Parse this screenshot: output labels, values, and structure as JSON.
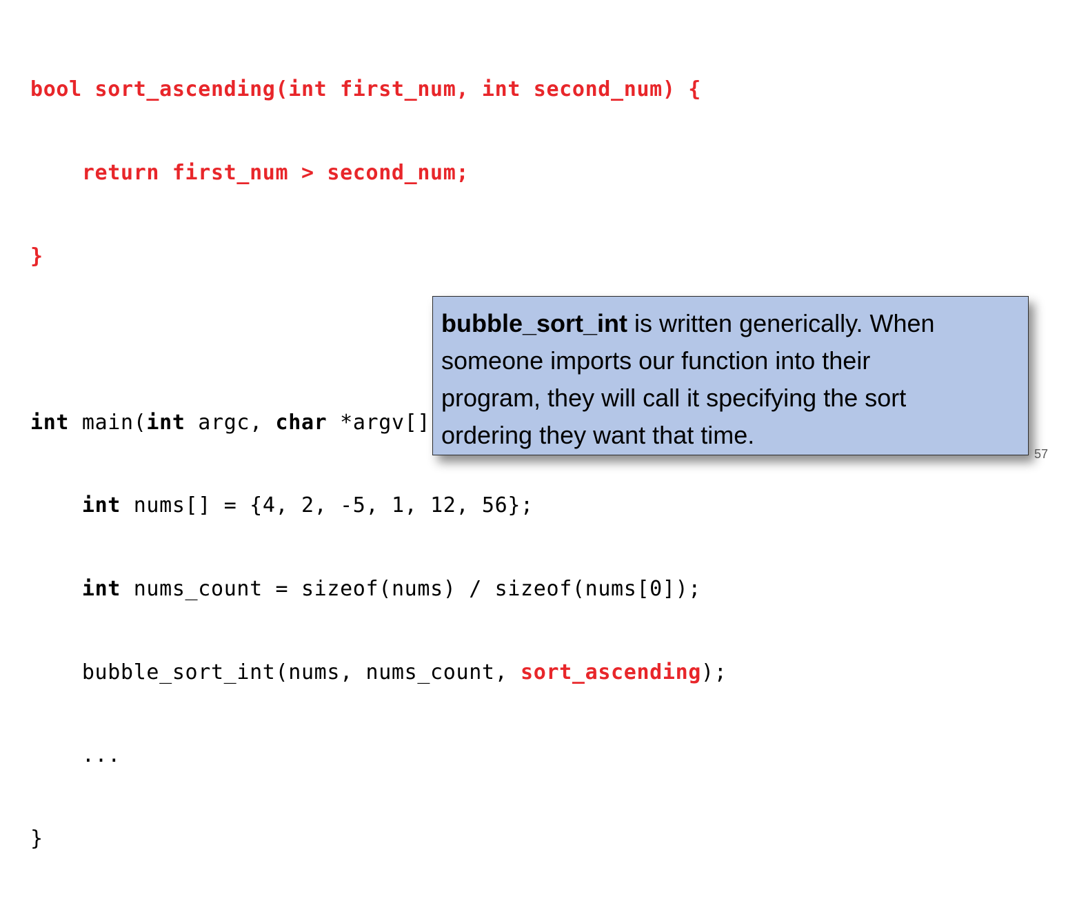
{
  "code": {
    "line1": {
      "text": "bool sort_ascending(int first_num, int second_num) {"
    },
    "line2": {
      "text": "    return first_num > second_num;"
    },
    "line3": {
      "text": "}"
    },
    "line5": {
      "kw1": "int",
      "t1": " main(",
      "kw2": "int",
      "t2": " argc, ",
      "kw3": "char",
      "t3": " *argv[]) {"
    },
    "line6": {
      "indent": "    ",
      "kw1": "int",
      "t1": " nums[] = {4, 2, -5, 1, 12, 56};"
    },
    "line7": {
      "indent": "    ",
      "kw1": "int",
      "t1": " nums_count = sizeof(nums) / sizeof(nums[0]);"
    },
    "line8": {
      "t1": "    bubble_sort_int(nums, nums_count, ",
      "highlight": "sort_ascending",
      "t2": ");"
    },
    "line9": {
      "text": "    ..."
    },
    "line10": {
      "text": "}"
    }
  },
  "callout": {
    "bold_term": "bubble_sort_int",
    "line1_rest": " is written generically.  When",
    "line2": "someone imports our function into their",
    "line3": "program, they will call it specifying the sort",
    "line4": "ordering they want that time."
  },
  "slide": {
    "page_number": "57"
  },
  "colors": {
    "highlight_red": "#e8262a",
    "callout_background": "#b4c6e7",
    "page_number_gray": "#595959"
  }
}
